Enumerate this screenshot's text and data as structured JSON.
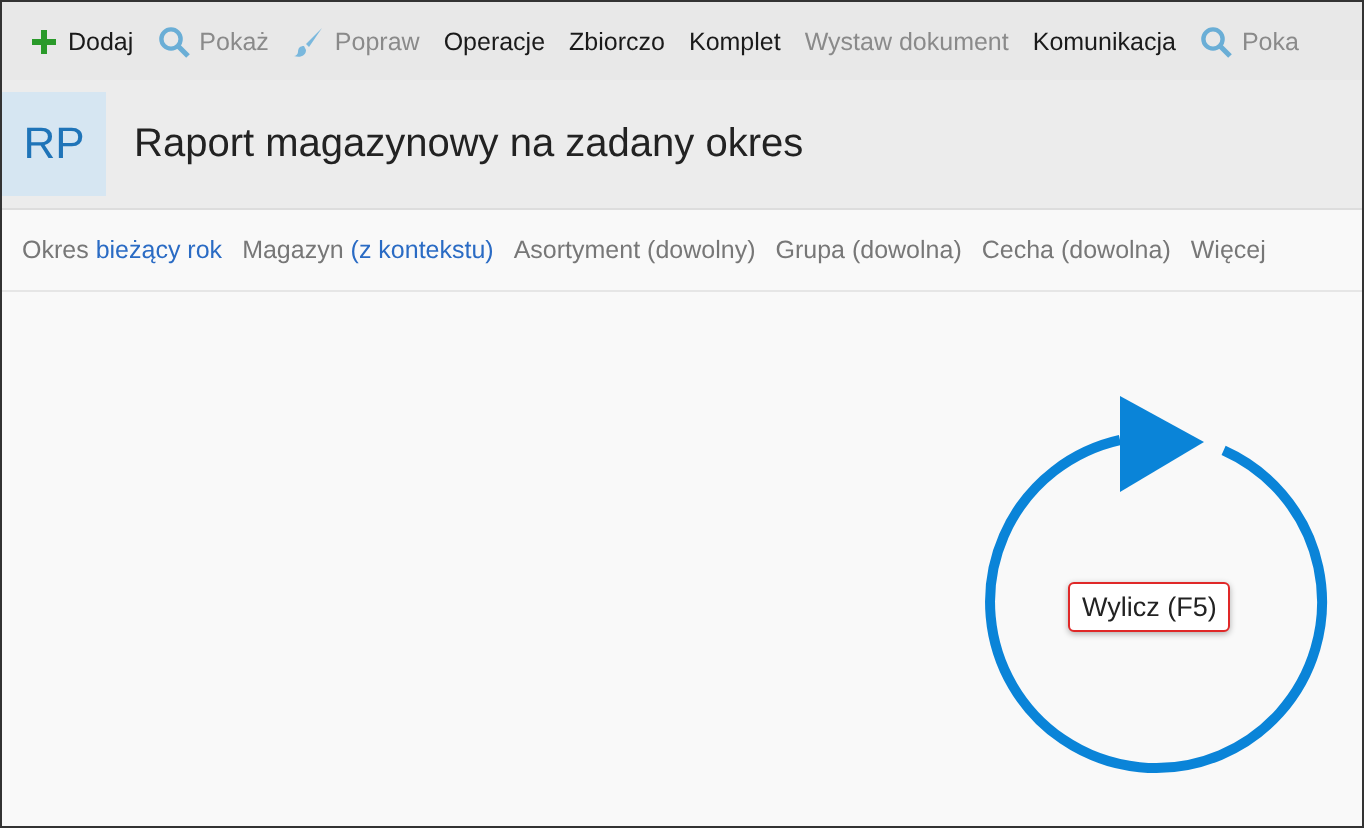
{
  "toolbar": [
    {
      "label": "Dodaj",
      "kind": "add",
      "disabled": false
    },
    {
      "label": "Pokaż",
      "kind": "search",
      "disabled": true
    },
    {
      "label": "Popraw",
      "kind": "brush",
      "disabled": true
    },
    {
      "label": "Operacje",
      "kind": "text",
      "disabled": false
    },
    {
      "label": "Zbiorczo",
      "kind": "text",
      "disabled": false
    },
    {
      "label": "Komplet",
      "kind": "text",
      "disabled": false
    },
    {
      "label": "Wystaw dokument",
      "kind": "text",
      "disabled": true
    },
    {
      "label": "Komunikacja",
      "kind": "text",
      "disabled": false
    },
    {
      "label": "Poka",
      "kind": "search",
      "disabled": true
    }
  ],
  "header": {
    "badge": "RP",
    "title": "Raport magazynowy na zadany okres"
  },
  "filters": [
    {
      "label": "Okres",
      "value": "bieżący rok",
      "set": true
    },
    {
      "label": "Magazyn",
      "value": "(z kontekstu)",
      "set": true
    },
    {
      "label": "Asortyment",
      "value": "(dowolny)",
      "set": false
    },
    {
      "label": "Grupa",
      "value": "(dowolna)",
      "set": false
    },
    {
      "label": "Cecha",
      "value": "(dowolna)",
      "set": false
    },
    {
      "label": "Więcej"
    }
  ],
  "calculate_button": {
    "label": "Wylicz (F5)"
  }
}
